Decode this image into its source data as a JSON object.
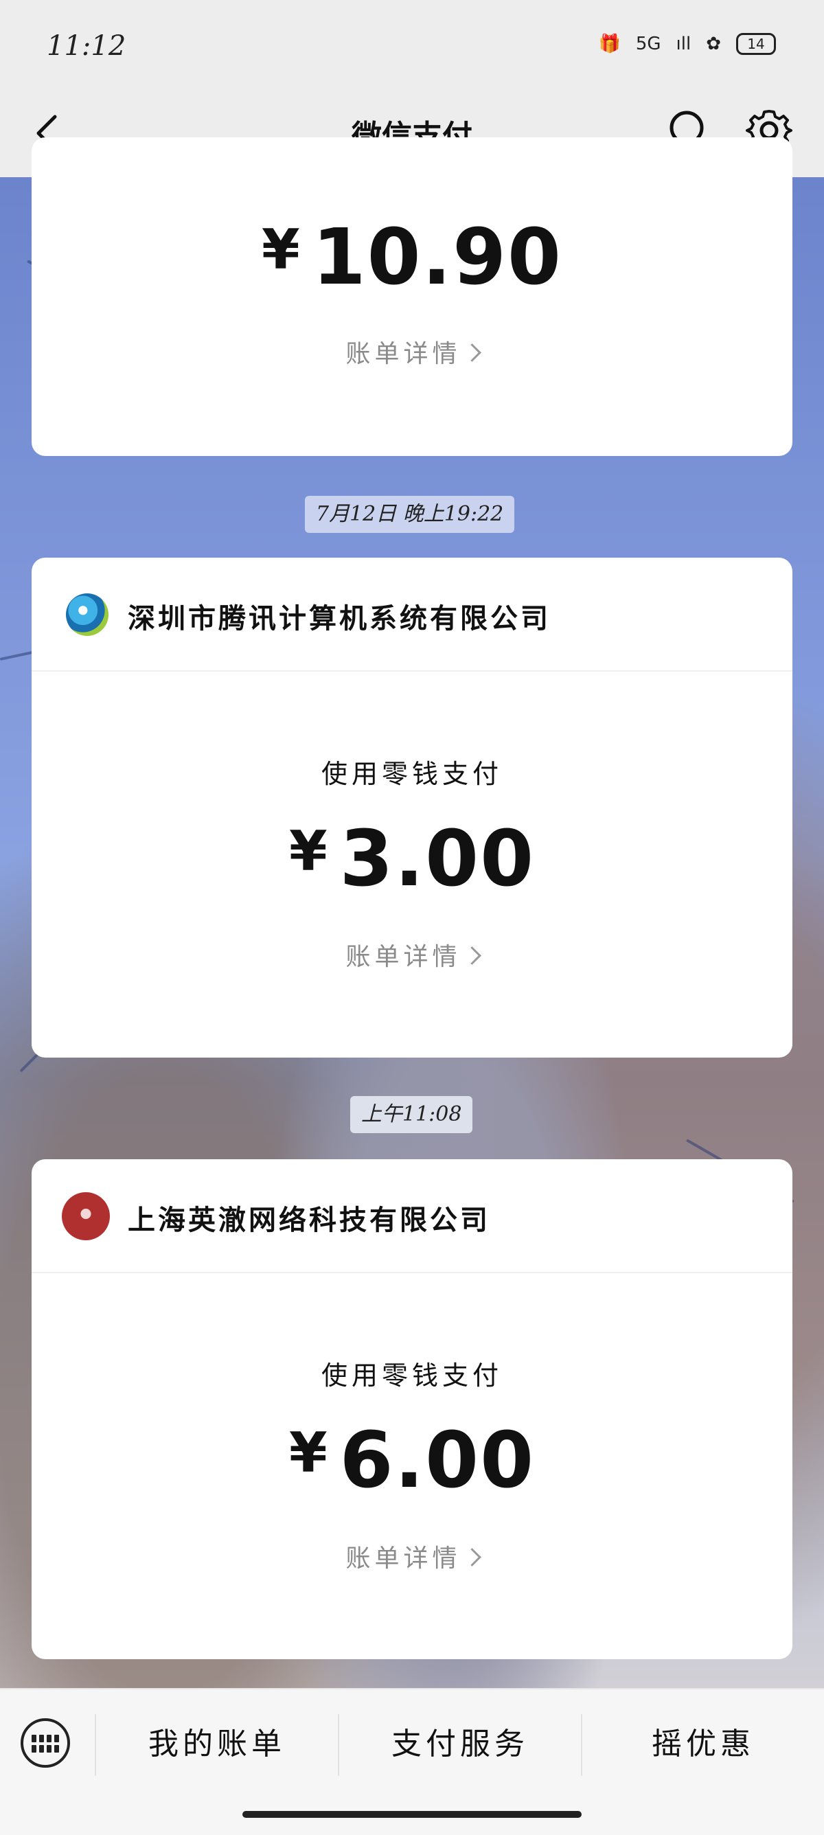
{
  "status": {
    "time": "11:12",
    "network": "5G",
    "battery": "14"
  },
  "nav": {
    "title": "微信支付"
  },
  "cards": [
    {
      "amount": "10.90",
      "currency": "¥",
      "detail_label": "账单详情"
    },
    {
      "timestamp": "7月12日 晚上19:22",
      "merchant": "深圳市腾讯计算机系统有限公司",
      "pay_method": "使用零钱支付",
      "amount": "3.00",
      "currency": "¥",
      "detail_label": "账单详情"
    },
    {
      "timestamp": "上午11:08",
      "merchant": "上海英澈网络科技有限公司",
      "pay_method": "使用零钱支付",
      "amount": "6.00",
      "currency": "¥",
      "detail_label": "账单详情"
    }
  ],
  "bottom_tabs": [
    "我的账单",
    "支付服务",
    "摇优惠"
  ],
  "icons": {
    "back": "back-icon",
    "search": "search-icon",
    "settings": "gear-icon",
    "keyboard": "keyboard-icon"
  }
}
